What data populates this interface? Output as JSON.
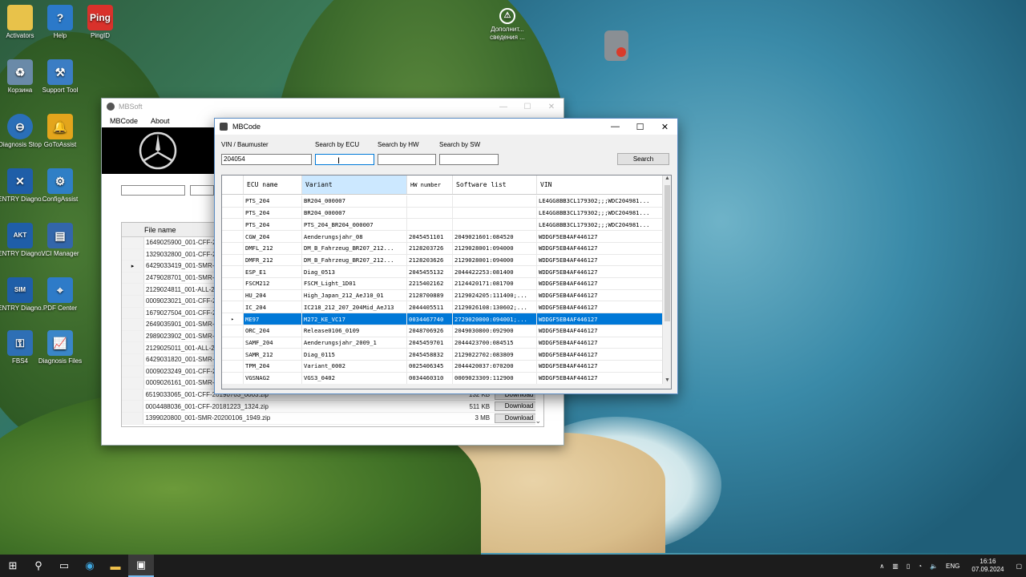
{
  "desktop": {
    "icons": [
      {
        "label": "Activators",
        "icon": "folder-icon",
        "color": "#e8c24a"
      },
      {
        "label": "Help",
        "icon": "help-icon",
        "color": "#2b79c9"
      },
      {
        "label": "PingID",
        "icon": "pingid-icon",
        "color": "#d9312b"
      },
      {
        "label": "Корзина",
        "icon": "recycle-bin-icon",
        "color": "#6a8aa8"
      },
      {
        "label": "Support Tool",
        "icon": "support-tool-icon",
        "color": "#3b7dc4"
      },
      {
        "label": "Diagnosis Stop",
        "icon": "diagnosis-stop-icon",
        "color": "#2a6fb8"
      },
      {
        "label": "GoToAssist",
        "icon": "gotoassist-icon",
        "color": "#e3a51c"
      },
      {
        "label": "XENTRY Diagno...",
        "icon": "xentry-icon",
        "color": "#1f5ea8"
      },
      {
        "label": "ConfigAssist",
        "icon": "configassist-icon",
        "color": "#2f7fc6"
      },
      {
        "label": "XENTRY Diagno...",
        "icon": "xentry-akt-icon",
        "color": "#1f5ea8"
      },
      {
        "label": "VCI Manager",
        "icon": "vci-manager-icon",
        "color": "#3366aa"
      },
      {
        "label": "XENTRY Diagno...",
        "icon": "xentry-sim-icon",
        "color": "#1f5ea8"
      },
      {
        "label": "PDF Center",
        "icon": "pdf-center-icon",
        "color": "#2e7bc8"
      },
      {
        "label": "FBS4",
        "icon": "fbs4-icon",
        "color": "#2e6fb5"
      },
      {
        "label": "Diagnosis Files",
        "icon": "diagnosis-files-icon",
        "color": "#3a86c9"
      },
      {
        "label": "Дополнит... сведения ...",
        "icon": "info-icon",
        "color": "#555555"
      }
    ],
    "icon_texts": {
      "ping": "Ping",
      "akt": "AKT",
      "sim": "SIM"
    }
  },
  "mbsoft": {
    "title": "MBSoft",
    "menu": [
      "MBCode",
      "About"
    ],
    "column_header": "File name",
    "rows": [
      {
        "name": "1649025900_001-CFF-2019",
        "size": "",
        "action": ""
      },
      {
        "name": "1329032800_001-CFF-2019",
        "size": "",
        "action": ""
      },
      {
        "name": "6429033419_001-SMR-202",
        "size": "",
        "action": ""
      },
      {
        "name": "2479028701_001-SMR-201",
        "size": "",
        "action": ""
      },
      {
        "name": "2129024811_001-ALL-2019",
        "size": "",
        "action": ""
      },
      {
        "name": "0009023021_001-CFF-2020",
        "size": "",
        "action": ""
      },
      {
        "name": "1679027504_001-CFF-2020",
        "size": "",
        "action": ""
      },
      {
        "name": "2649035901_001-SMR-201",
        "size": "",
        "action": ""
      },
      {
        "name": "2989023902_001-SMR-202",
        "size": "",
        "action": ""
      },
      {
        "name": "2129025011_001-ALL-2019",
        "size": "",
        "action": ""
      },
      {
        "name": "6429031820_001-SMR-202",
        "size": "",
        "action": ""
      },
      {
        "name": "0009023249_001-CFF-2018",
        "size": "",
        "action": ""
      },
      {
        "name": "0009026161_001-SMR-202",
        "size": "",
        "action": ""
      },
      {
        "name": "6519033065_001-CFF-20190703_0003.zip",
        "size": "132 KB",
        "action": "Download"
      },
      {
        "name": "0004488036_001-CFF-20181223_1324.zip",
        "size": "511 KB",
        "action": "Download"
      },
      {
        "name": "1399020800_001-SMR-20200106_1949.zip",
        "size": "3 MB",
        "action": "Download"
      }
    ],
    "current_row_marker": "▸"
  },
  "mbcode": {
    "title": "MBCode",
    "labels": {
      "vin": "VIN / Baumuster",
      "ecu": "Search by ECU",
      "hw": "Search by HW",
      "sw": "Search by SW"
    },
    "values": {
      "vin": "204054",
      "ecu": "",
      "hw": "",
      "sw": ""
    },
    "search_label": "Search",
    "columns": [
      "ECU name",
      "Variant",
      "HW number",
      "Software list",
      "VIN"
    ],
    "rows": [
      [
        "PTS_204",
        "BR204_000007",
        "",
        "",
        "LE4GG8BB3CL179302;;;WDC204981..."
      ],
      [
        "PTS_204",
        "BR204_000007",
        "",
        "",
        "LE4GG8BB3CL179302;;;WDC204981..."
      ],
      [
        "PTS_204",
        "PTS_204_BR204_000007",
        "",
        "",
        "LE4GG8BB3CL179302;;;WDC204981..."
      ],
      [
        "CGW_204",
        "Aenderungsjahr_08",
        "2045451101",
        "2049021601:084520",
        "WDDGF5EB4AF446127"
      ],
      [
        "DMFL_212",
        "DM_B_Fahrzeug_BR207_212...",
        "2128203726",
        "2129028001:094000",
        "WDDGF5EB4AF446127"
      ],
      [
        "DMFR_212",
        "DM_B_Fahrzeug_BR207_212...",
        "2128203626",
        "2129028001:094000",
        "WDDGF5EB4AF446127"
      ],
      [
        "ESP_E1",
        "Diag_0513",
        "2045455132",
        "2044422253:081400",
        "WDDGF5EB4AF446127"
      ],
      [
        "FSCM212",
        "FSCM_Light_1D01",
        "2215402162",
        "2124420171:081700",
        "WDDGF5EB4AF446127"
      ],
      [
        "HU_204",
        "High_Japan_212_AeJ10_01",
        "2128700889",
        "2129024205:111400;...",
        "WDDGF5EB4AF446127"
      ],
      [
        "IC_204",
        "IC218_212_207_204Mid_AeJ13",
        "2044405511",
        "2129026108:130602;...",
        "WDDGF5EB4AF446127"
      ],
      [
        "ME97",
        "M272_KE_VC17",
        "0034467740",
        "2729020000:094001;...",
        "WDDGF5EB4AF446127"
      ],
      [
        "ORC_204",
        "Release0106_0109",
        "2048706926",
        "2049030800:092900",
        "WDDGF5EB4AF446127"
      ],
      [
        "SAMF_204",
        "Aenderungsjahr_2009_1",
        "2045459701",
        "2044423700:084515",
        "WDDGF5EB4AF446127"
      ],
      [
        "SAMR_212",
        "Diag_0115",
        "2045458832",
        "2129022702:083809",
        "WDDGF5EB4AF446127"
      ],
      [
        "TPM_204",
        "Variant_0002",
        "0025406345",
        "2044420037:070200",
        "WDDGF5EB4AF446127"
      ],
      [
        "VGSNAG2",
        "VGS3_0402",
        "0034460310",
        "0009023309:112900",
        "WDDGF5EB4AF446127"
      ]
    ],
    "selected_row": 10,
    "row_marker": "▸"
  },
  "taskbar": {
    "language": "ENG",
    "time": "16:16",
    "date": "07.09.2024"
  }
}
